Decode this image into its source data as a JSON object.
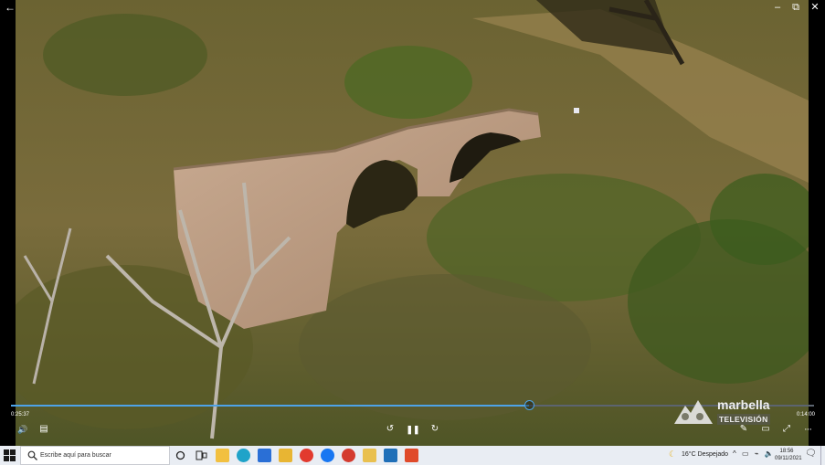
{
  "window": {
    "back_glyph": "←",
    "minimize_glyph": "–",
    "maximize_glyph": "⧉",
    "close_glyph": "✕"
  },
  "player": {
    "time_elapsed": "0:25:37",
    "time_remaining": "0:14:00",
    "progress_fraction": 0.645,
    "accent_color": "#4da3e8",
    "controls": [
      {
        "name": "volume-icon",
        "glyph": "🔊"
      },
      {
        "name": "captions-icon",
        "glyph": "▤"
      },
      {
        "name": "rewind-10-icon",
        "glyph": "↺"
      },
      {
        "name": "pause-icon",
        "glyph": "❚❚"
      },
      {
        "name": "forward-30-icon",
        "glyph": "↻"
      },
      {
        "name": "edit-pen-icon",
        "glyph": "✎"
      },
      {
        "name": "mini-view-icon",
        "glyph": "▭"
      },
      {
        "name": "fullscreen-icon",
        "glyph": "⤢"
      },
      {
        "name": "more-options-icon",
        "glyph": "···"
      }
    ]
  },
  "watermark": {
    "name": "marbella",
    "sub": "TELEVISIÓN"
  },
  "taskbar": {
    "search_placeholder": "Escribe aquí para buscar",
    "apps": [
      {
        "name": "file-explorer-icon",
        "color": "#f2c040"
      },
      {
        "name": "edge-icon",
        "color": "#1fa3c9"
      },
      {
        "name": "mail-icon",
        "color": "#2a6fd6"
      },
      {
        "name": "folder-icon",
        "color": "#e8b533"
      },
      {
        "name": "chrome-icon",
        "color": "#e23a2e"
      },
      {
        "name": "facebook-icon",
        "color": "#1877f2"
      },
      {
        "name": "chrome-alt-icon",
        "color": "#d43b2f"
      },
      {
        "name": "files-icon",
        "color": "#e9c04f"
      },
      {
        "name": "app-blue-icon",
        "color": "#1f6fb8"
      },
      {
        "name": "app-red-icon",
        "color": "#e04a2a"
      }
    ],
    "weather": "16°C  Despejado",
    "time": "18:56",
    "date": "09/11/2021"
  }
}
